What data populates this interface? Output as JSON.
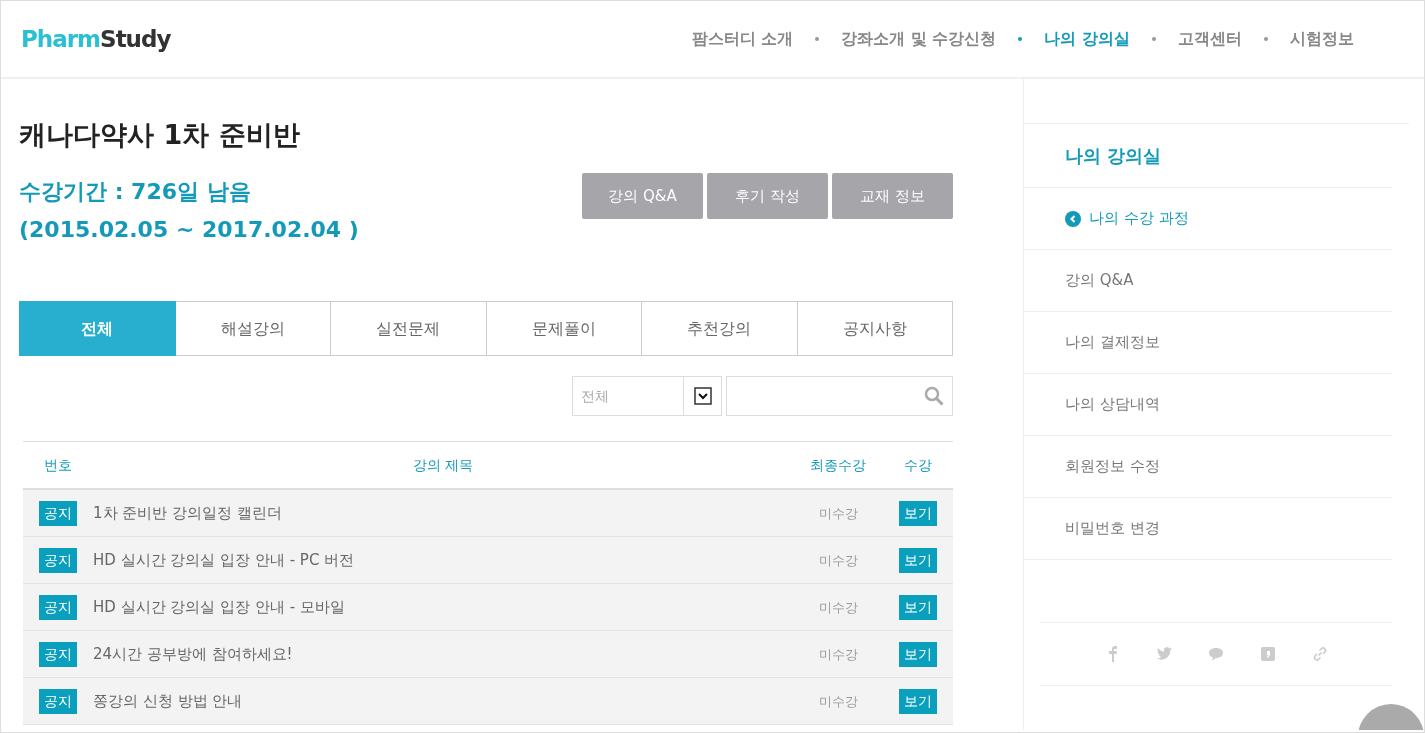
{
  "header": {
    "logo": {
      "part_1": "Pharm",
      "part_2": "Study"
    },
    "nav": [
      {
        "label": "팜스터디 소개",
        "selected": false
      },
      {
        "label": "강좌소개 및 수강신청",
        "selected": false
      },
      {
        "label": "나의 강의실",
        "selected": true
      },
      {
        "label": "고객센터",
        "selected": false
      },
      {
        "label": "시험정보",
        "selected": false
      }
    ]
  },
  "course": {
    "title": "캐나다약사 1차 준비반",
    "period": "수강기간 : 726일 남음",
    "dates": "(2015.02.05 ~ 2017.02.04 )"
  },
  "actions": [
    "강의 Q&A",
    "후기 작성",
    "교재 정보"
  ],
  "tabs": [
    {
      "label": "전체",
      "selected": true
    },
    {
      "label": "해설강의",
      "selected": false
    },
    {
      "label": "실전문제",
      "selected": false
    },
    {
      "label": "문제풀이",
      "selected": false
    },
    {
      "label": "추천강의",
      "selected": false
    },
    {
      "label": "공지사항",
      "selected": false
    }
  ],
  "filter": {
    "select": "전체"
  },
  "table": {
    "columns": [
      "번호",
      "강의 제목",
      "최종수강",
      "수강"
    ],
    "rows": [
      {
        "tag": "공지",
        "title": "1차 준비반 강의일정 캘린더",
        "status": "미수강",
        "action": "보기"
      },
      {
        "tag": "공지",
        "title": "HD 실시간 강의실 입장 안내 - PC 버전",
        "status": "미수강",
        "action": "보기"
      },
      {
        "tag": "공지",
        "title": "HD 실시간 강의실 입장 안내 - 모바일",
        "status": "미수강",
        "action": "보기"
      },
      {
        "tag": "공지",
        "title": "24시간 공부방에 참여하세요!",
        "status": "미수강",
        "action": "보기"
      },
      {
        "tag": "공지",
        "title": "쫑강의 신청 방법 안내",
        "status": "미수강",
        "action": "보기"
      }
    ]
  },
  "sidebar": {
    "title": "나의 강의실",
    "items": [
      {
        "label": "나의 수강 과정",
        "selected": true
      },
      {
        "label": "강의 Q&A",
        "selected": false
      },
      {
        "label": "나의 결제정보",
        "selected": false
      },
      {
        "label": "나의 상담내역",
        "selected": false
      },
      {
        "label": "회원정보 수정",
        "selected": false
      },
      {
        "label": "비밀번호 변경",
        "selected": false
      }
    ],
    "share": [
      {
        "kind": "facebook"
      },
      {
        "kind": "twitter"
      },
      {
        "kind": "chat"
      },
      {
        "kind": "story"
      },
      {
        "kind": "link"
      }
    ]
  }
}
